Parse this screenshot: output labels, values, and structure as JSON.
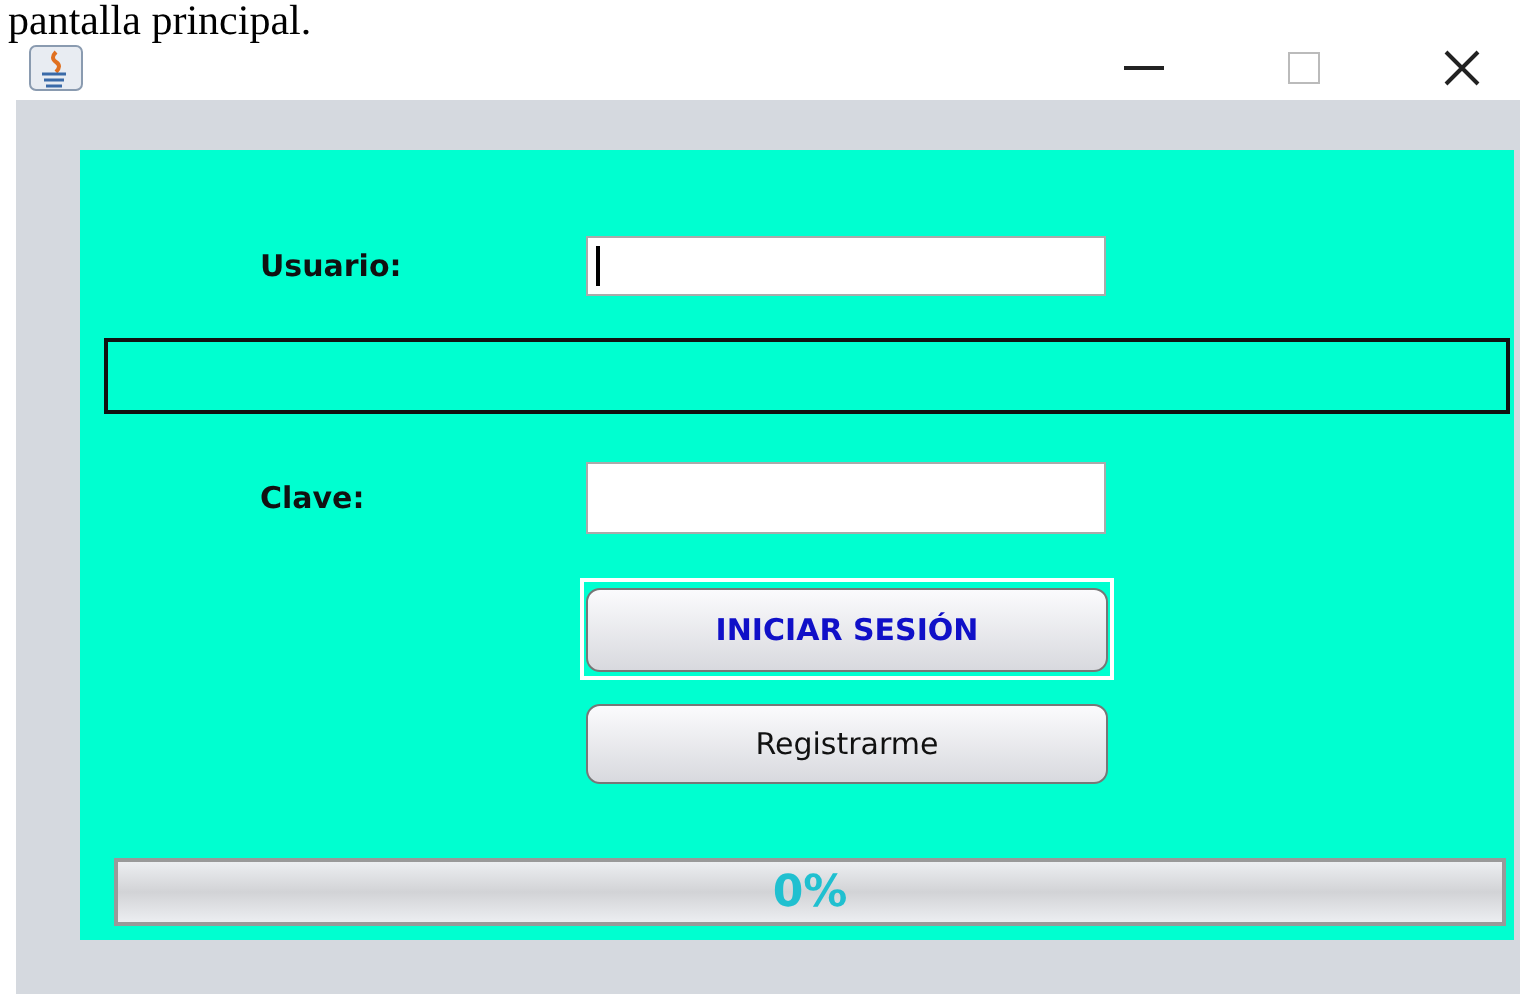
{
  "caption": "pantalla principal.",
  "window": {
    "controls": [
      {
        "kind": "minimize"
      },
      {
        "kind": "maximize"
      },
      {
        "kind": "close"
      }
    ]
  },
  "form": {
    "user_label": "Usuario:",
    "password_label": "Clave:",
    "login_button": {
      "label": "INICIAR SESIÓN",
      "focused": true
    },
    "register_button": {
      "label": "Registrarme",
      "focused": false
    },
    "progress": {
      "level": 0,
      "reading": "0%"
    }
  }
}
